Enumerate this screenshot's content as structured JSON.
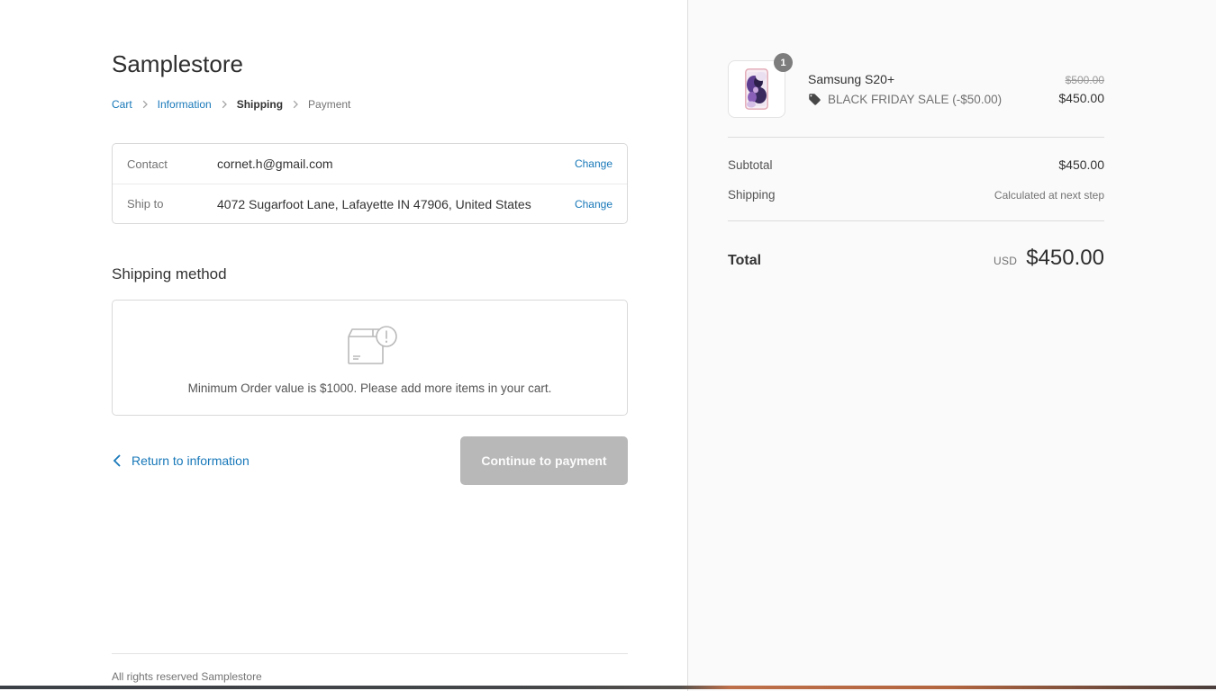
{
  "store": {
    "name": "Samplestore"
  },
  "breadcrumb": {
    "items": [
      {
        "label": "Cart"
      },
      {
        "label": "Information"
      },
      {
        "label": "Shipping"
      },
      {
        "label": "Payment"
      }
    ]
  },
  "review": {
    "contact_label": "Contact",
    "contact_value": "cornet.h@gmail.com",
    "ship_to_label": "Ship to",
    "ship_to_value": "4072 Sugarfoot Lane, Lafayette IN 47906, United States",
    "change_label": "Change"
  },
  "shipping_method": {
    "heading": "Shipping method",
    "empty_message": "Minimum Order value is $1000. Please add more items in your cart."
  },
  "actions": {
    "return_label": "Return to information",
    "continue_label": "Continue to payment"
  },
  "footer": {
    "text": "All rights reserved Samplestore"
  },
  "order_summary": {
    "item": {
      "name": "Samsung S20+",
      "quantity": "1",
      "discount_label": "BLACK FRIDAY SALE (-$50.00)",
      "original_price": "$500.00",
      "price": "$450.00"
    },
    "subtotal_label": "Subtotal",
    "subtotal_value": "$450.00",
    "shipping_label": "Shipping",
    "shipping_value": "Calculated at next step",
    "total_label": "Total",
    "currency": "USD",
    "total_value": "$450.00"
  },
  "colors": {
    "link_blue": "#1878b9",
    "accent_orange": "#bd6f4a",
    "disabled_button_gray": "#b8b8b8",
    "sidebar_background": "#fafafa"
  }
}
